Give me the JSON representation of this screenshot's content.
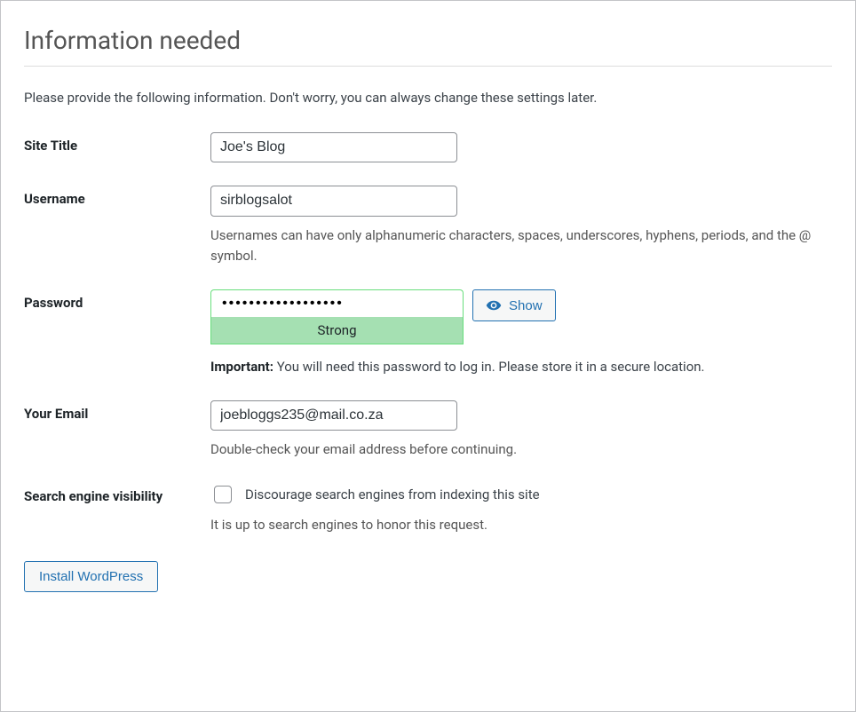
{
  "heading": "Information needed",
  "intro": "Please provide the following information. Don't worry, you can always change these settings later.",
  "fields": {
    "site_title": {
      "label": "Site Title",
      "value": "Joe's Blog"
    },
    "username": {
      "label": "Username",
      "value": "sirblogsalot",
      "help": "Usernames can have only alphanumeric characters, spaces, underscores, hyphens, periods, and the @ symbol."
    },
    "password": {
      "label": "Password",
      "masked_value": "••••••••••••••••••",
      "show_button": "Show",
      "strength": "Strong",
      "important_label": "Important:",
      "important_text": "You will need this password to log in. Please store it in a secure location."
    },
    "email": {
      "label": "Your Email",
      "value": "joebloggs235@mail.co.za",
      "help": "Double-check your email address before continuing."
    },
    "visibility": {
      "label": "Search engine visibility",
      "checkbox_label": "Discourage search engines from indexing this site",
      "help": "It is up to search engines to honor this request."
    }
  },
  "submit_label": "Install WordPress"
}
